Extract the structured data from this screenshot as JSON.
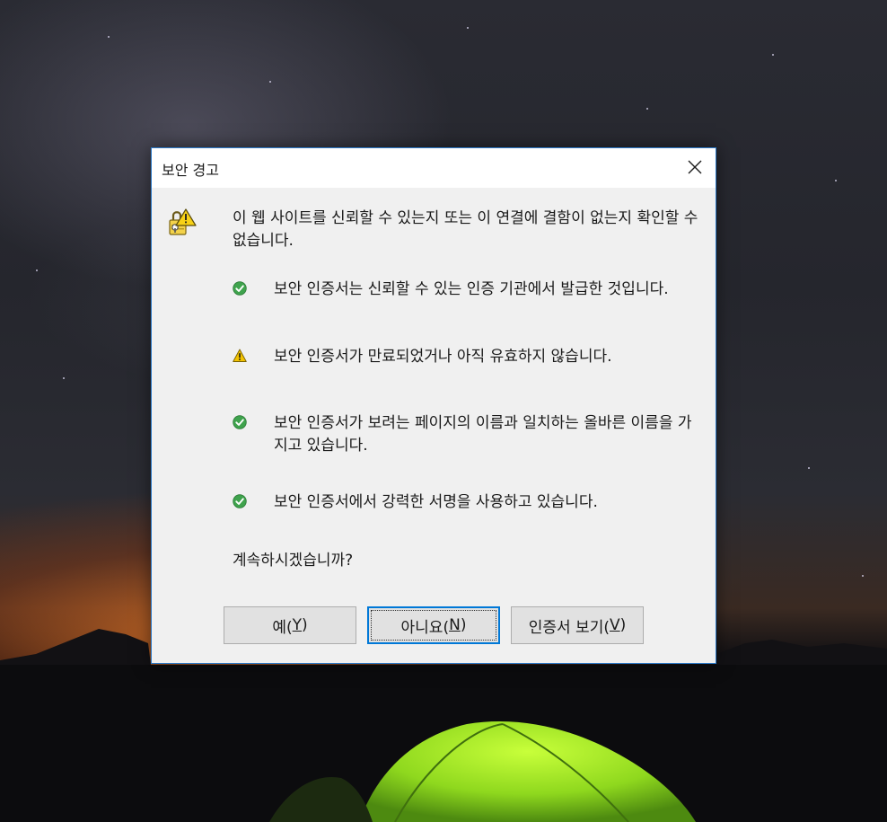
{
  "dialog": {
    "title": "보안 경고",
    "intro": "이 웹 사이트를 신뢰할 수 있는지 또는 이 연결에 결함이 없는지 확인할 수 없습니다.",
    "items": [
      {
        "status": "ok",
        "icon": "green-check-icon",
        "text": "보안 인증서는 신뢰할 수 있는 인증 기관에서 발급한 것입니다."
      },
      {
        "status": "warning",
        "icon": "warning-triangle-icon",
        "text": "보안 인증서가 만료되었거나 아직 유효하지 않습니다."
      },
      {
        "status": "ok",
        "icon": "green-check-icon",
        "text": "보안 인증서가 보려는 페이지의 이름과 일치하는 올바른 이름을 가지고 있습니다."
      },
      {
        "status": "ok",
        "icon": "green-check-icon",
        "text": "보안 인증서에서 강력한 서명을 사용하고 있습니다."
      }
    ],
    "question": "계속하시겠습니까?",
    "buttons": {
      "yes": {
        "label": "예(",
        "mnemonic": "Y",
        "suffix": ")"
      },
      "no": {
        "label": "아니요(",
        "mnemonic": "N",
        "suffix": ")"
      },
      "view_cert": {
        "label": "인증서 보기(",
        "mnemonic": "V",
        "suffix": ")"
      }
    },
    "default_button": "no"
  },
  "icons": {
    "close": "close-icon",
    "header": "lock-warning-icon"
  },
  "colors": {
    "check_green": "#3fa34d",
    "warning_yellow": "#f2c200",
    "focus_blue": "#0078d7"
  }
}
